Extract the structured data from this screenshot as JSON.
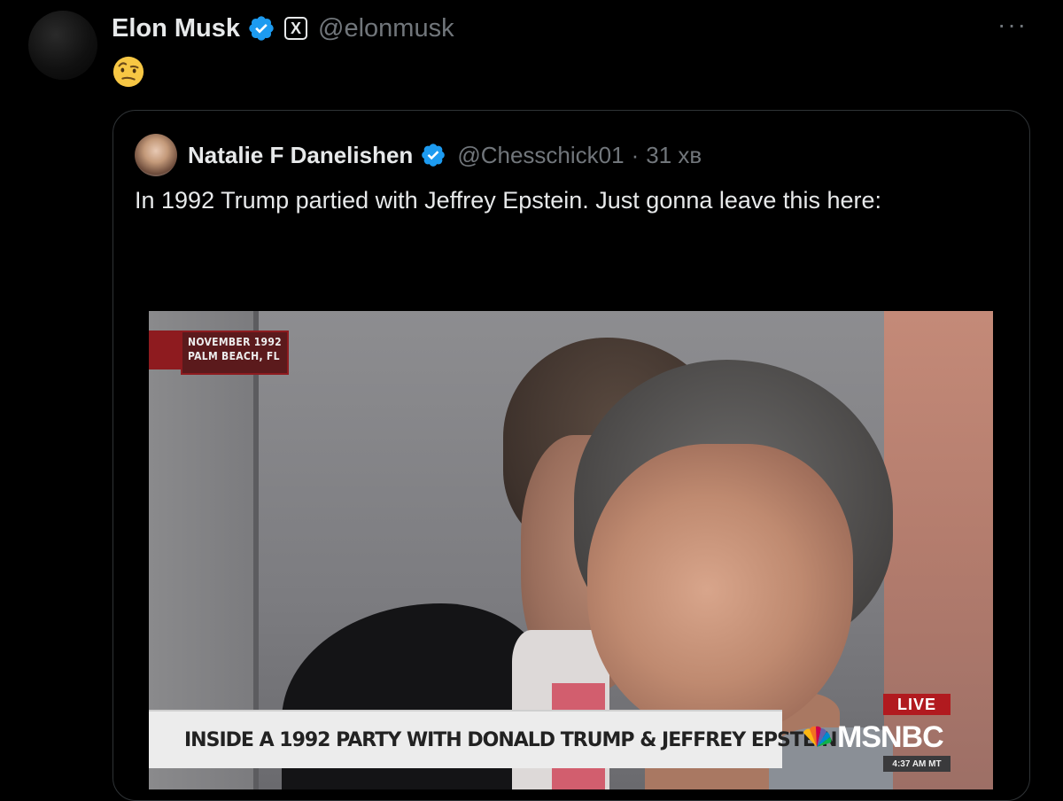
{
  "tweet": {
    "author_name": "Elon Musk",
    "author_handle": "@elonmusk",
    "affiliate_badge": "X",
    "more_label": "···",
    "emoji": "face-with-raised-eyebrow",
    "verified_color": "#1d9bf0"
  },
  "quoted": {
    "author_name": "Natalie F Danelishen",
    "author_handle": "@Chesschick01",
    "separator": "·",
    "time": "31 хв",
    "text": "In 1992 Trump partied with Jeffrey Epstein. Just gonna leave this here:"
  },
  "media": {
    "dateline_line1": "NOVEMBER 1992",
    "dateline_line2": "PALM BEACH, FL",
    "lower_third": "INSIDE A 1992 PARTY WITH DONALD TRUMP & JEFFREY EPSTEIN",
    "live_label": "LIVE",
    "network": "MSNBC",
    "clock": "4:37 AM MT"
  }
}
